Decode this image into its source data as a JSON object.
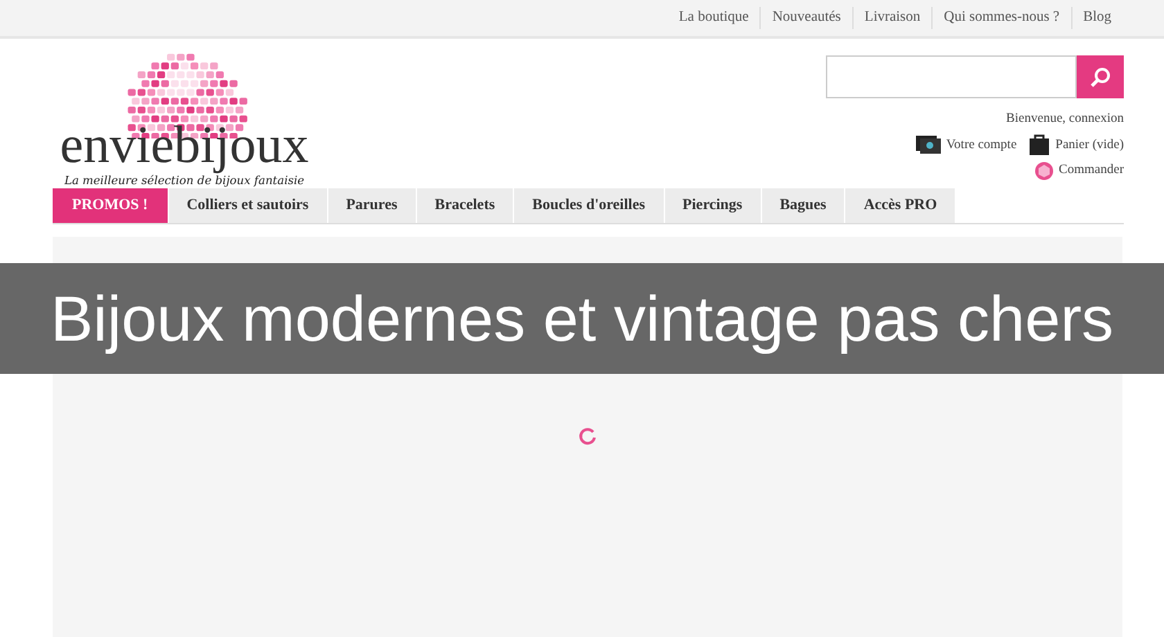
{
  "top_links": [
    "La boutique",
    "Nouveautés",
    "Livraison",
    "Qui sommes-nous ?",
    "Blog"
  ],
  "logo": {
    "name": "enviebijoux",
    "tagline": "La meilleure sélection de bijoux fantaisie"
  },
  "account": {
    "welcome": "Bienvenue, connexion",
    "account_link": "Votre compte",
    "cart": "Panier (vide)",
    "order": "Commander"
  },
  "menu": [
    {
      "label": "PROMOS !",
      "kind": "promo"
    },
    {
      "label": "Colliers et sautoirs",
      "kind": "normal"
    },
    {
      "label": "Parures",
      "kind": "normal"
    },
    {
      "label": "Bracelets",
      "kind": "normal"
    },
    {
      "label": "Boucles d'oreilles",
      "kind": "normal"
    },
    {
      "label": "Piercings",
      "kind": "normal"
    },
    {
      "label": "Bagues",
      "kind": "normal"
    },
    {
      "label": "Accès PRO",
      "kind": "normal"
    }
  ],
  "caption": "Bijoux modernes et vintage pas chers"
}
